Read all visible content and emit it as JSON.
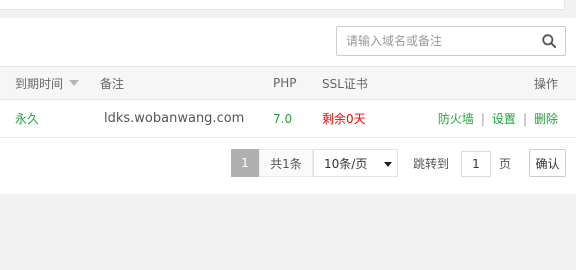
{
  "search": {
    "placeholder": "请输入域名或备注",
    "value": ""
  },
  "table": {
    "headers": {
      "expire": "到期时间",
      "remark": "备注",
      "php": "PHP",
      "ssl": "SSL证书",
      "ops": "操作"
    },
    "rows": [
      {
        "expire": "永久",
        "remark": "ldks.wobanwang.com",
        "php": "7.0",
        "ssl": "剩余0天",
        "ops": {
          "firewall": "防火墙",
          "settings": "设置",
          "delete": "删除",
          "sep": "|"
        }
      }
    ]
  },
  "pager": {
    "current": "1",
    "total": "共1条",
    "page_size": "10条/页",
    "jump_label": "跳转到",
    "jump_value": "1",
    "unit": "页",
    "confirm": "确认"
  },
  "colors": {
    "accent_green": "#20a53a",
    "danger_red": "#ef0808"
  }
}
